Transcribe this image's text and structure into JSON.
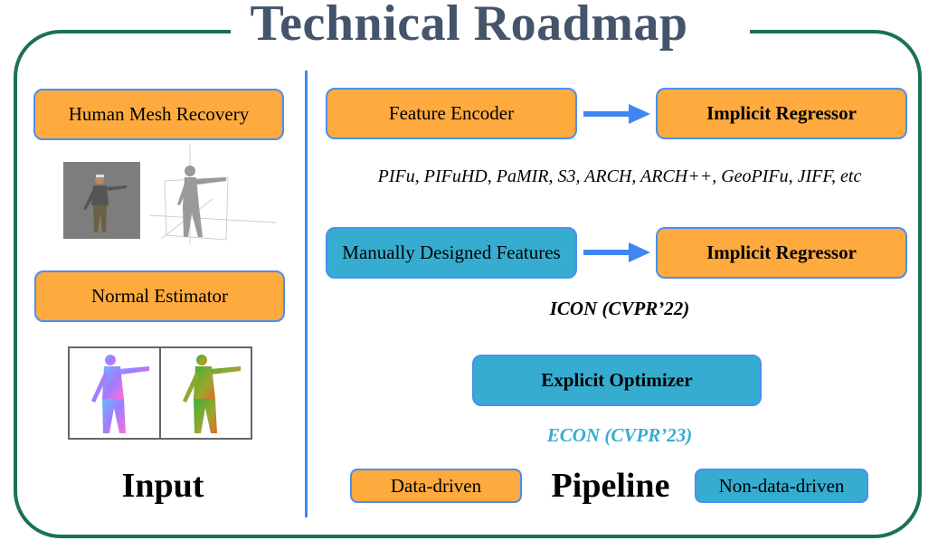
{
  "title": "Technical Roadmap",
  "colors": {
    "frame": "#1b7154",
    "title": "#44546a",
    "data_driven": "#ffaa3f",
    "non_data_driven": "#36add0",
    "box_border": "#4a8ff0",
    "arrow": "#3f86f4",
    "econ_caption": "#36add0"
  },
  "input_panel": {
    "label": "Input",
    "modules": [
      {
        "label": "Human Mesh Recovery",
        "type": "data-driven"
      },
      {
        "label": "Normal Estimator",
        "type": "data-driven"
      }
    ],
    "images": [
      {
        "name": "input-photo",
        "description": "person photo on gray background"
      },
      {
        "name": "smpl-mesh",
        "description": "gray human body mesh with 3D axes"
      },
      {
        "name": "front-normal-map",
        "description": "front normal map (purple/blue)"
      },
      {
        "name": "back-normal-map",
        "description": "back normal map (green/orange)"
      }
    ]
  },
  "pipeline_panel": {
    "label": "Pipeline",
    "rows": [
      {
        "from": {
          "label": "Feature Encoder",
          "type": "data-driven"
        },
        "to": {
          "label": "Implicit Regressor",
          "type": "data-driven"
        },
        "caption": "PIFu, PIFuHD, PaMIR, S3, ARCH, ARCH++, GeoPIFu, JIFF, etc"
      },
      {
        "from": {
          "label": "Manually Designed Features",
          "type": "non-data-driven"
        },
        "to": {
          "label": "Implicit Regressor",
          "type": "data-driven"
        },
        "caption": "ICON (CVPR’22)"
      },
      {
        "single": {
          "label": "Explicit Optimizer",
          "type": "non-data-driven"
        },
        "caption": "ECON (CVPR’23)"
      }
    ],
    "legend": [
      {
        "label": "Data-driven",
        "type": "data-driven"
      },
      {
        "label": "Non-data-driven",
        "type": "non-data-driven"
      }
    ]
  }
}
